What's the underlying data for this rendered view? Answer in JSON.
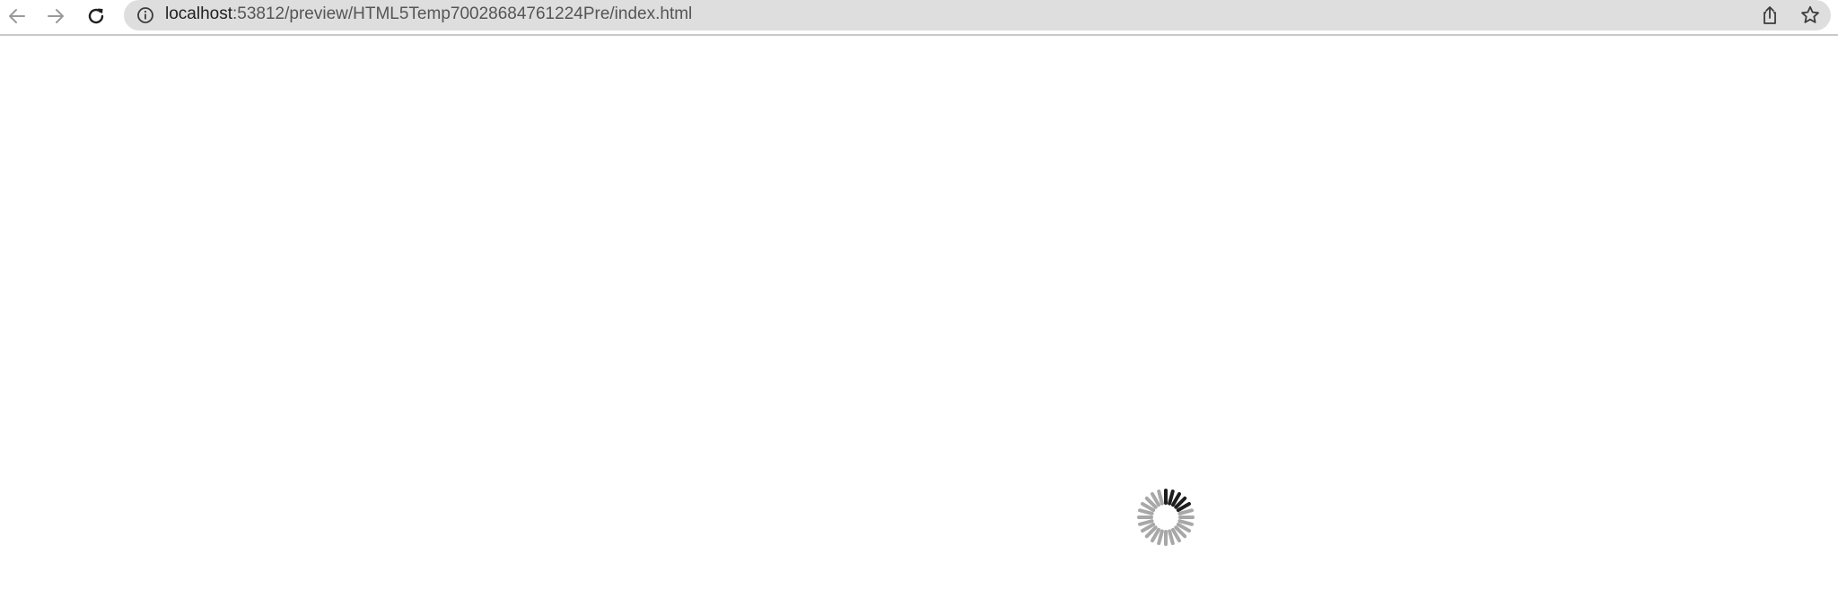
{
  "browser": {
    "url_host": "localhost",
    "url_rest": ":53812/preview/HTML5Temp70028684761224Pre/index.html",
    "icons": {
      "back": "arrow-left-icon",
      "forward": "arrow-right-icon",
      "reload": "reload-icon",
      "site_info": "info-circle-icon",
      "share": "share-icon",
      "bookmark": "star-icon"
    }
  },
  "page": {
    "state": "loading",
    "spinner_icon": "loading-spinner-icon"
  }
}
